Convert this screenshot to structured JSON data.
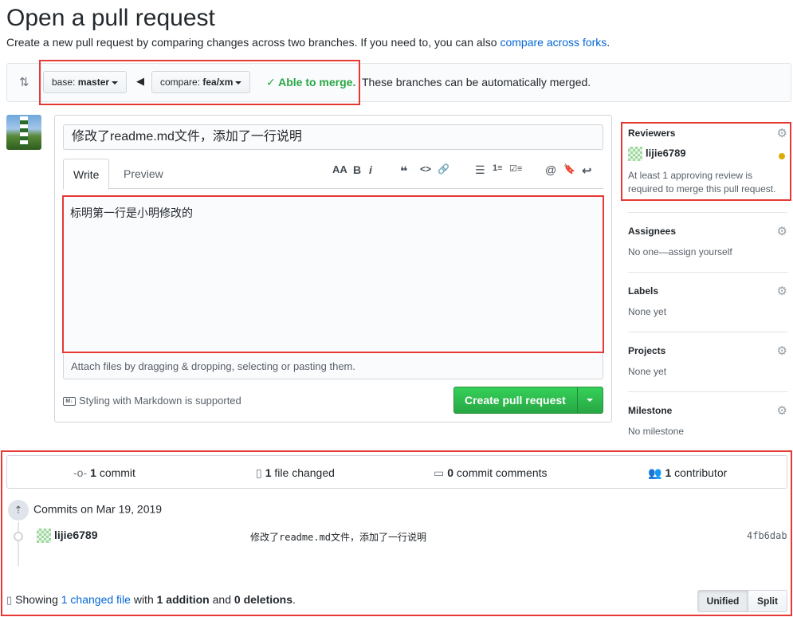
{
  "header": {
    "title": "Open a pull request",
    "subtitle": "Create a new pull request by comparing changes across two branches. If you need to, you can also ",
    "subtitle_link": "compare across forks",
    "subtitle_end": "."
  },
  "range": {
    "base_prefix": "base:",
    "base_branch": "master",
    "compare_prefix": "compare:",
    "compare_branch": "fea/xm",
    "merge_status": "✓ Able to merge.",
    "merge_note": "These branches can be automatically merged."
  },
  "form": {
    "title_value": "修改了readme.md文件，添加了一行说明",
    "tabs": [
      "Write",
      "Preview"
    ],
    "toolbar": [
      "AA",
      "B",
      "i",
      "❝",
      "<>",
      "🔗",
      "☰",
      "1≡",
      "☑≡",
      "@",
      "🔖",
      "↩"
    ],
    "body_value": "标明第一行是小明修改的",
    "attach_hint": "Attach files by dragging & dropping, selecting or pasting them.",
    "markdown_note": "Styling with Markdown is supported",
    "markdown_icon_text": "M↓",
    "create_button": "Create pull request"
  },
  "sidebar": {
    "reviewers": {
      "label": "Reviewers",
      "user": "lijie6789",
      "note": "At least 1 approving review is required to merge this pull request."
    },
    "assignees": {
      "label": "Assignees",
      "value": "No one—assign yourself"
    },
    "labels": {
      "label": "Labels",
      "value": "None yet"
    },
    "projects": {
      "label": "Projects",
      "value": "None yet"
    },
    "milestone": {
      "label": "Milestone",
      "value": "No milestone"
    }
  },
  "stats": {
    "commits_count": "1",
    "commits_label": "commit",
    "files_count": "1",
    "files_label": "file changed",
    "comments_count": "0",
    "comments_label": "commit comments",
    "contributors_count": "1",
    "contributors_label": "contributor"
  },
  "commits": {
    "group_label": "Commits on Mar 19, 2019",
    "items": [
      {
        "author": "lijie6789",
        "message": "修改了readme.md文件，添加了一行说明",
        "sha": "4fb6dab"
      }
    ]
  },
  "diff": {
    "showing": "Showing ",
    "changed_link": "1 changed file",
    "with": " with ",
    "additions": "1 addition",
    "and": " and ",
    "deletions": "0 deletions",
    "end": ".",
    "view_unified": "Unified",
    "view_split": "Split"
  },
  "colors": {
    "link": "#0366d6",
    "success": "#28a745",
    "highlight_box": "#e53935",
    "pending_dot": "#dbab09"
  }
}
